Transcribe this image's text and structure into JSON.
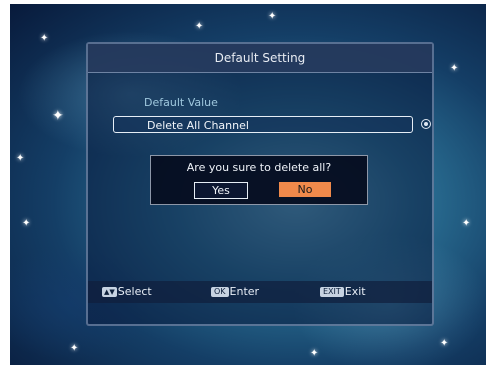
{
  "dialog": {
    "title": "Default Setting",
    "section_label": "Default Value",
    "selected_item": "Delete All Channel"
  },
  "confirm": {
    "message": "Are you sure to delete all?",
    "yes_label": "Yes",
    "no_label": "No",
    "focused": "No"
  },
  "footer": {
    "select_key": "▲▼",
    "select_label": "Select",
    "ok_key": "OK",
    "ok_label": "Enter",
    "exit_key": "EXIT",
    "exit_label": "Exit"
  },
  "colors": {
    "focus_accent": "#f08a4b"
  }
}
